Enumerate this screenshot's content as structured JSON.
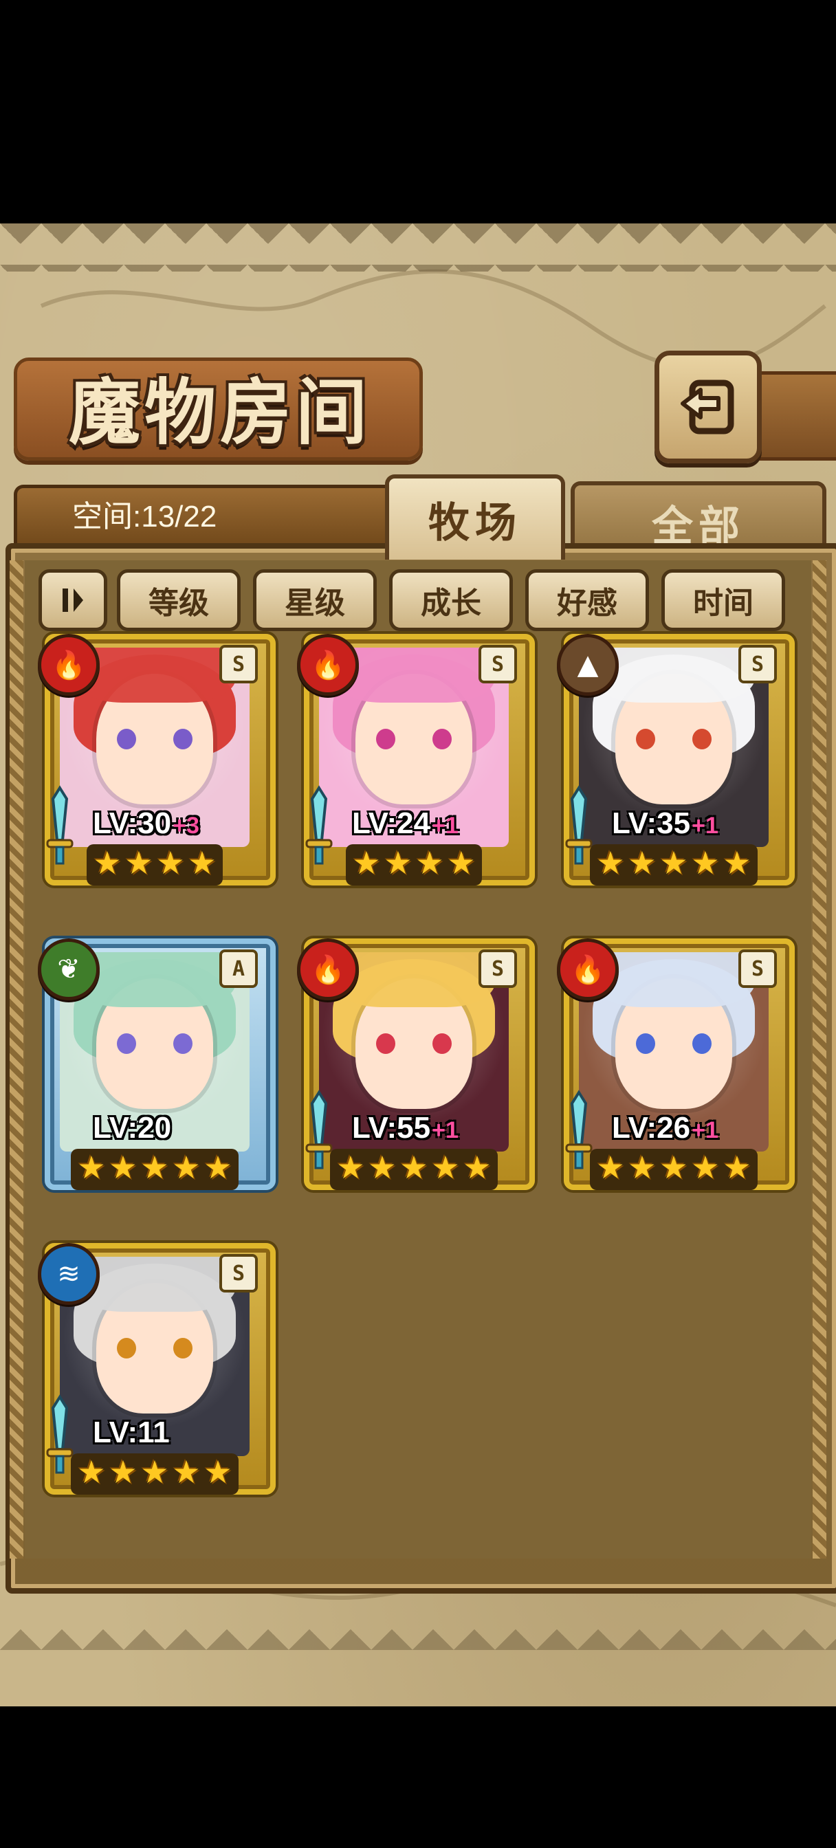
{
  "header": {
    "title": "魔物房间",
    "back_icon": "back-arrow-icon"
  },
  "tabs": {
    "space_label": "空间:13/22",
    "active": "牧场",
    "inactive": "全部"
  },
  "sort": {
    "toggle_label": "⏸",
    "options": [
      "等级",
      "星级",
      "成长",
      "好感",
      "时间"
    ]
  },
  "colors": {
    "fire": "#c9211c",
    "earth": "#6b4a2b",
    "nature": "#3f7d2a",
    "water": "#1f6fb5",
    "gold_frame": "#e0b72b",
    "blue_frame": "#8fc3e3",
    "plus": "#ff4fa0"
  },
  "monsters": [
    {
      "element": "fire",
      "element_icon": "flame-icon",
      "rank": "S",
      "level": "LV:30",
      "bonus": "+3",
      "stars": 4,
      "frame": "gold",
      "hair": "#d9403a",
      "eye": "#7a5cc9",
      "bg": "#f0c6d9"
    },
    {
      "element": "fire",
      "element_icon": "flame-icon",
      "rank": "S",
      "level": "LV:24",
      "bonus": "+1",
      "stars": 4,
      "frame": "gold",
      "hair": "#f08cc4",
      "eye": "#ce3c8d",
      "bg": "#f6b5d9"
    },
    {
      "element": "earth",
      "element_icon": "mountain-icon",
      "rank": "S",
      "level": "LV:35",
      "bonus": "+1",
      "stars": 5,
      "frame": "gold",
      "hair": "#f4f4f6",
      "eye": "#d54a2f",
      "bg": "#3b3438"
    },
    {
      "element": "nature",
      "element_icon": "leaf-icon",
      "rank": "A",
      "level": "LV:20",
      "bonus": "",
      "stars": 5,
      "frame": "blue",
      "hair": "#9ed7be",
      "eye": "#7c6ad3",
      "bg": "#cfe6d9"
    },
    {
      "element": "fire",
      "element_icon": "flame-icon",
      "rank": "S",
      "level": "LV:55",
      "bonus": "+1",
      "stars": 5,
      "frame": "gold",
      "hair": "#f3c75a",
      "eye": "#d8384d",
      "bg": "#5b2430"
    },
    {
      "element": "fire",
      "element_icon": "flame-icon",
      "rank": "S",
      "level": "LV:26",
      "bonus": "+1",
      "stars": 5,
      "frame": "gold",
      "hair": "#d7e1f2",
      "eye": "#4c6ad8",
      "bg": "#8e5a42"
    },
    {
      "element": "water",
      "element_icon": "waves-icon",
      "rank": "S",
      "level": "LV:11",
      "bonus": "",
      "stars": 5,
      "frame": "gold",
      "hair": "#d8d8d8",
      "eye": "#d58a1e",
      "bg": "#3a3a45"
    }
  ]
}
